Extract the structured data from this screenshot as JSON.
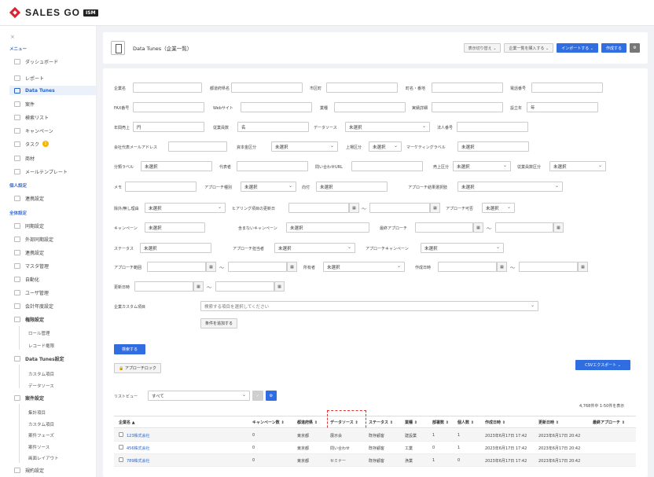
{
  "brand": {
    "name": "SALES GO",
    "badge": "ISM"
  },
  "sidebar": {
    "close": "×",
    "menu_label": "メニュー",
    "items": [
      {
        "label": "ダッシュボード"
      },
      {
        "label": "レポート"
      },
      {
        "label": "Data Tunes"
      },
      {
        "label": "案件"
      },
      {
        "label": "検索リスト"
      },
      {
        "label": "キャンペーン"
      },
      {
        "label": "タスク",
        "badge": "1"
      },
      {
        "label": "商材"
      },
      {
        "label": "メールテンプレート"
      }
    ],
    "personal_label": "個人設定",
    "personal_items": [
      {
        "label": "連携設定"
      }
    ],
    "global_label": "全体設定",
    "global_items": [
      {
        "label": "同期設定"
      },
      {
        "label": "外部同期設定"
      },
      {
        "label": "連携設定"
      },
      {
        "label": "マスタ管理"
      },
      {
        "label": "自動化"
      },
      {
        "label": "ユーザ管理"
      },
      {
        "label": "会計年度設定"
      }
    ],
    "perm_label": "権限設定",
    "perm_subs": [
      "ロール管理",
      "レコード権限"
    ],
    "dt_label": "Data Tunes設定",
    "dt_subs": [
      "カスタム項目",
      "データソース"
    ],
    "deal_label": "案件設定",
    "deal_subs": [
      "集計項目",
      "カスタム項目",
      "案件フェーズ",
      "案件ソース",
      "画面レイアウト"
    ],
    "last_label": "規約設定"
  },
  "header": {
    "title": "Data Tunes（企業一覧）",
    "btn_view": "表示切り替え ⌄",
    "btn_buy": "企業一覧を購入する ⌄",
    "btn_import": "インポートする ⌄",
    "btn_create": "作成する",
    "btn_settings": "⚙"
  },
  "form": {
    "company_name": "企業名",
    "prefecture": "都道府県名",
    "city": "市区町",
    "address": "町名・番地",
    "phone": "電話番号",
    "fax": "FAX番号",
    "website": "Webサイト",
    "industry": "業種",
    "fiscal_month": "実績詳細",
    "founded": "設立年",
    "founded_unit": "年",
    "revenue": "年間売上",
    "revenue_unit": "円",
    "employees": "従業員数",
    "employees_unit": "名",
    "data_source": "データソース",
    "data_source_val": "未選択",
    "corp_number": "法人番号",
    "rep_email": "会社代表メールアドレス",
    "capital_div": "資本金区分",
    "capital_div_val": "未選択",
    "listing_div": "上場区分",
    "listing_div_val": "未選択",
    "marketing_label": "マーケティングラベル",
    "marketing_val": "未選択",
    "category_label": "分類ラベル",
    "category_val": "未選択",
    "representative": "代表者",
    "contact_url": "問い合わせURL",
    "revenue_div": "売上区分",
    "revenue_div_val": "未選択",
    "employees_div": "従業員数区分",
    "employees_div_val": "未選択",
    "memo": "メモ",
    "approach_rank": "アプローチ種別",
    "approach_rank_val": "未選択",
    "direction": "向付",
    "direction_val": "未選択",
    "approach_result": "アプローチ結果選択肢",
    "approach_result_val": "未選択",
    "hidden_reason": "除外/無し理由",
    "hidden_reason_val": "未選択",
    "hearing_date": "ヒアリング項目の更新日",
    "approach_ok": "アプローチ可否",
    "approach_ok_val": "未選択",
    "campaign": "キャンペーン",
    "campaign_val": "未選択",
    "campaign_ex": "含まないキャンペーン",
    "campaign_ex_val": "未選択",
    "last_approach": "最終アプローチ",
    "status": "ステータス",
    "status_val": "未選択",
    "approach_owner": "アプローチ担当者",
    "approach_owner_val": "未選択",
    "approach_campaign": "アプローチキャンペーン",
    "approach_campaign_val": "未選択",
    "approach_period": "アプローチ範囲",
    "owner": "所有者",
    "owner_val": "未選択",
    "created": "作成日時",
    "updated": "更新日時",
    "custom_item": "企業カスタム項目",
    "custom_placeholder": "検索する項目を選択してください",
    "add_condition": "条件を追加する",
    "search_btn": "検索する",
    "approach_lock": "アプローチロック",
    "csv_export": "CSVエクスポート ⌄",
    "list_view": "リストビュー",
    "list_view_val": "すべて",
    "count": "4,768件中 1-50件を表示",
    "cal": "▦",
    "tilde": "〜"
  },
  "table": {
    "headers": [
      "企業名 ▲",
      "キャンペーン数 ⇕",
      "都道府県 ⇕",
      "データソース ⇕",
      "ステータス ⇕",
      "業種 ⇕",
      "部署数 ⇕",
      "個人数 ⇕",
      "作成日時 ⇕",
      "更新日時 ⇕",
      "最終アプローチ ⇕"
    ],
    "rows": [
      [
        "123株式会社",
        "0",
        "東京都",
        "展示会",
        "既存顧客",
        "建設業",
        "1",
        "1",
        "2023年6月17日 17:42",
        "2023年6月17日 20:42",
        ""
      ],
      [
        "456株式会社",
        "0",
        "東京都",
        "問い合わせ",
        "既存顧客",
        "工業",
        "0",
        "1",
        "2023年6月17日 17:42",
        "2023年6月17日 20:42",
        ""
      ],
      [
        "789株式会社",
        "0",
        "東京都",
        "セミナー",
        "既存顧客",
        "漁業",
        "1",
        "0",
        "2023年6月17日 17:42",
        "2023年6月17日 20:42",
        ""
      ]
    ]
  }
}
